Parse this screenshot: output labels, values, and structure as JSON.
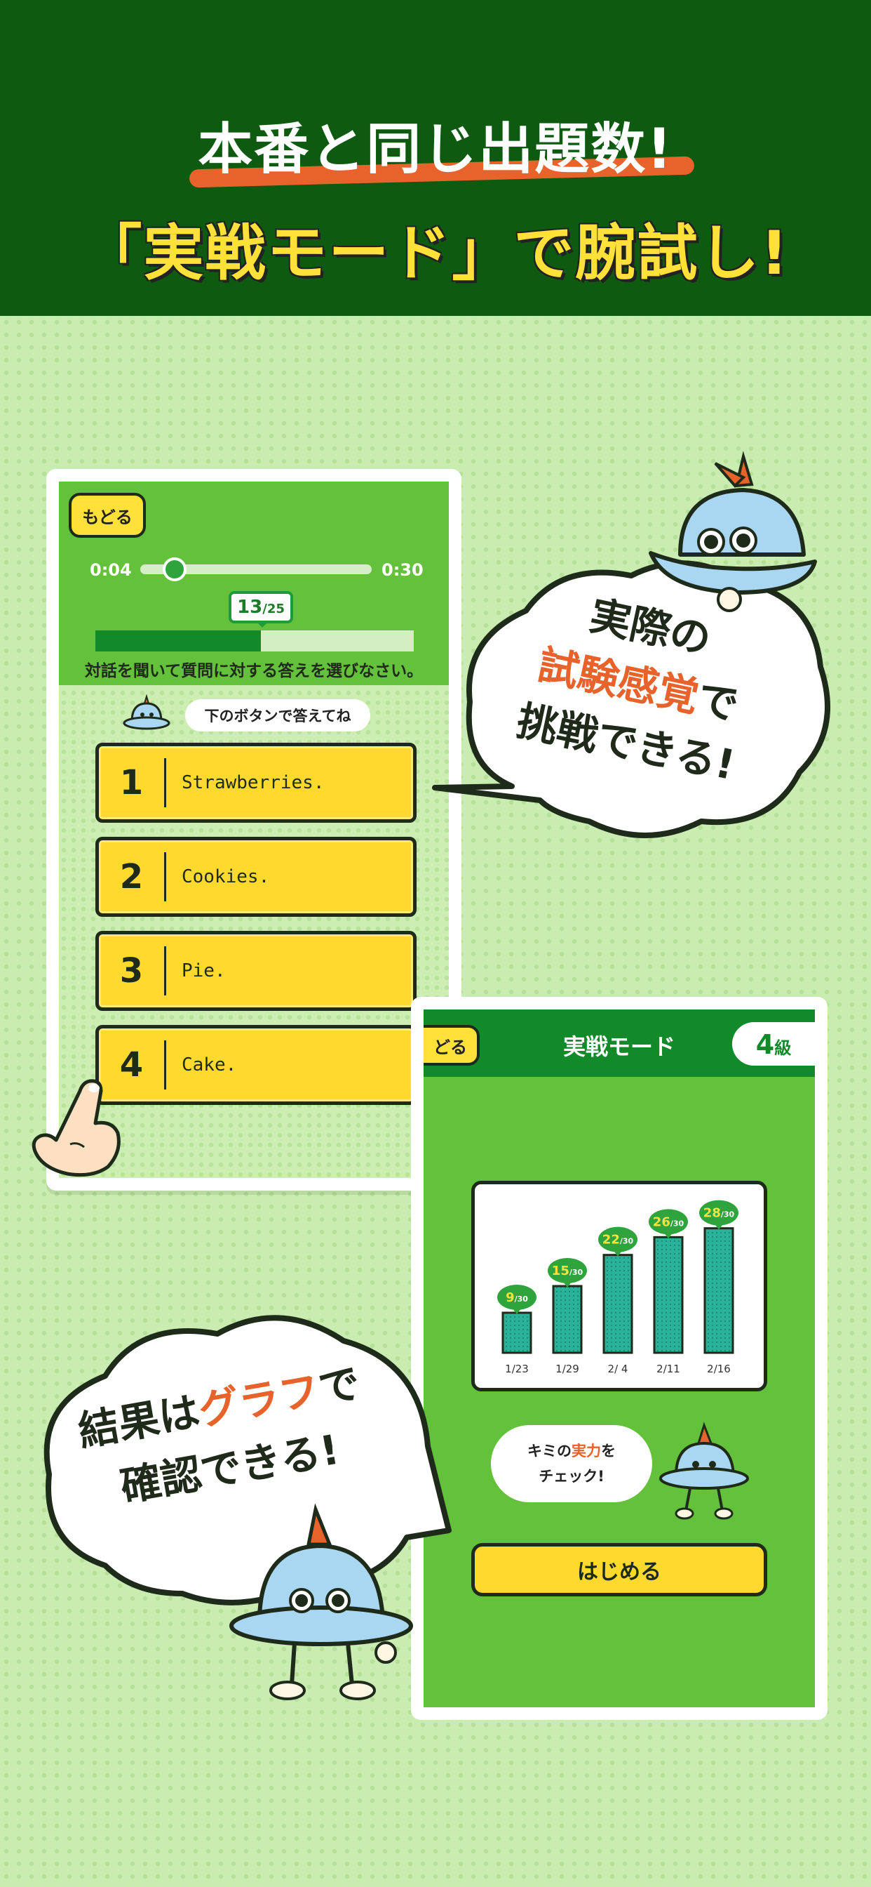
{
  "header": {
    "line1": "本番と同じ出題数!",
    "line2": "「実戦モード」で腕試し!"
  },
  "quiz_screen": {
    "back_label": "もどる",
    "time_current": "0:04",
    "time_total": "0:30",
    "playback_fraction": 0.13,
    "question_current": "13",
    "question_total": "/25",
    "progress_fraction": 0.52,
    "instruction": "対話を聞いて質問に対する答えを選びなさい。",
    "hint": "下のボタンで答えてね",
    "answers": [
      {
        "num": "1",
        "text": "Strawberries."
      },
      {
        "num": "2",
        "text": "Cookies."
      },
      {
        "num": "3",
        "text": "Pie."
      },
      {
        "num": "4",
        "text": "Cake."
      }
    ]
  },
  "bubble_right": {
    "line1": "実際の",
    "line2_highlight": "試験感覚",
    "line2_rest": "で",
    "line3": "挑戦できる!"
  },
  "result_screen": {
    "back_label": "どる",
    "title": "実戦モード",
    "grade_number": "4",
    "grade_unit": "級",
    "check_line1_pre": "キミの",
    "check_line1_hl": "実力",
    "check_line1_post": "を",
    "check_line2": "チェック!",
    "start_label": "はじめる"
  },
  "chart_data": {
    "type": "bar",
    "categories": [
      "1/23",
      "1/29",
      "2/ 4",
      "2/11",
      "2/16"
    ],
    "values": [
      9,
      15,
      22,
      26,
      28
    ],
    "value_labels": [
      "9/30",
      "15/30",
      "22/30",
      "26/30",
      "28/30"
    ],
    "ylim": [
      0,
      30
    ],
    "bar_color": "#2ab39a",
    "badge_color": "#2fa33c",
    "badge_text_color": "#ffe13a"
  },
  "bubble_left": {
    "line1_pre": "結果は",
    "line1_hl": "グラフ",
    "line1_post": "で",
    "line2": "確認できる!"
  },
  "colors": {
    "header_bg": "#0d5a10",
    "accent_orange": "#e8632b",
    "yellow": "#ffd92e",
    "green": "#64c13b"
  }
}
